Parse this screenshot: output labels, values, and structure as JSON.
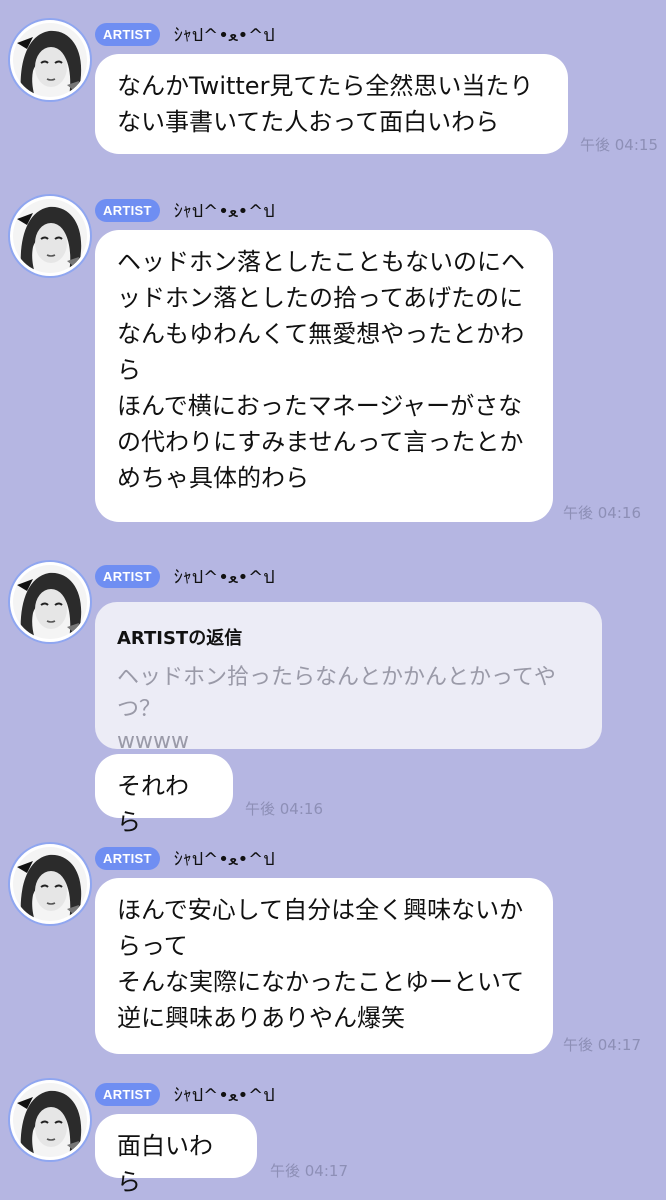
{
  "messages": [
    {
      "badge": "ARTIST",
      "name": "ｼｬป^•ﻌ•^ป",
      "text": "なんかTwitter見てたら全然思い当たり\nない事書いてた人おって面白いわら",
      "time": "午後 04:15"
    },
    {
      "badge": "ARTIST",
      "name": "ｼｬป^•ﻌ•^ป",
      "text": "ヘッドホン落としたこともないのにヘ\nッドホン落としたの拾ってあげたのに\nなんもゆわんくて無愛想やったとかわ\nら\nほんで横におったマネージャーがさな\nの代わりにすみませんって言ったとか\nめちゃ具体的わら",
      "time": "午後 04:16"
    },
    {
      "badge": "ARTIST",
      "name": "ｼｬป^•ﻌ•^ป",
      "reply_title": "ARTISTの返信",
      "reply_text": "ヘッドホン拾ったらなんとかかんとかってやつ？\nwwww",
      "text": "それわら",
      "time": "午後 04:16"
    },
    {
      "badge": "ARTIST",
      "name": "ｼｬป^•ﻌ•^ป",
      "text": "ほんで安心して自分は全く興味ないか\nらって\nそんな実際になかったことゆーといて\n逆に興味ありありやん爆笑",
      "time": "午後 04:17"
    },
    {
      "badge": "ARTIST",
      "name": "ｼｬป^•ﻌ•^ป",
      "text": "面白いわら",
      "time": "午後 04:17"
    }
  ],
  "colors": {
    "background": "#b5b6e2",
    "badge": "#6f8ef2",
    "bubble": "#ffffff",
    "reply_bg": "#ececf6",
    "time": "#8d8fb6"
  }
}
